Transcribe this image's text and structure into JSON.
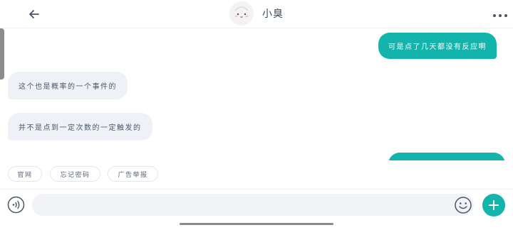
{
  "header": {
    "title": "小臭",
    "back_icon": "arrow-left-icon",
    "more_icon": "more-horizontal-icon",
    "avatar": "avatar-cartoon-face"
  },
  "messages": [
    {
      "side": "out",
      "text": "可是点了几天都没有反应啊"
    },
    {
      "side": "in",
      "text": "这个也是概率的一个事件的"
    },
    {
      "side": "in",
      "text": "并不是点到一定次数的一定触发的"
    },
    {
      "side": "out",
      "text": ""
    }
  ],
  "quick_replies": [
    "官网",
    "忘记密码",
    "广告举报"
  ],
  "composer": {
    "placeholder": "",
    "voice_icon": "voice-icon",
    "emoji_icon": "emoji-icon",
    "plus_icon": "plus-icon"
  },
  "colors": {
    "accent": "#13b4ab",
    "incoming_bubble": "#eef1f5",
    "text": "#4a5468"
  }
}
